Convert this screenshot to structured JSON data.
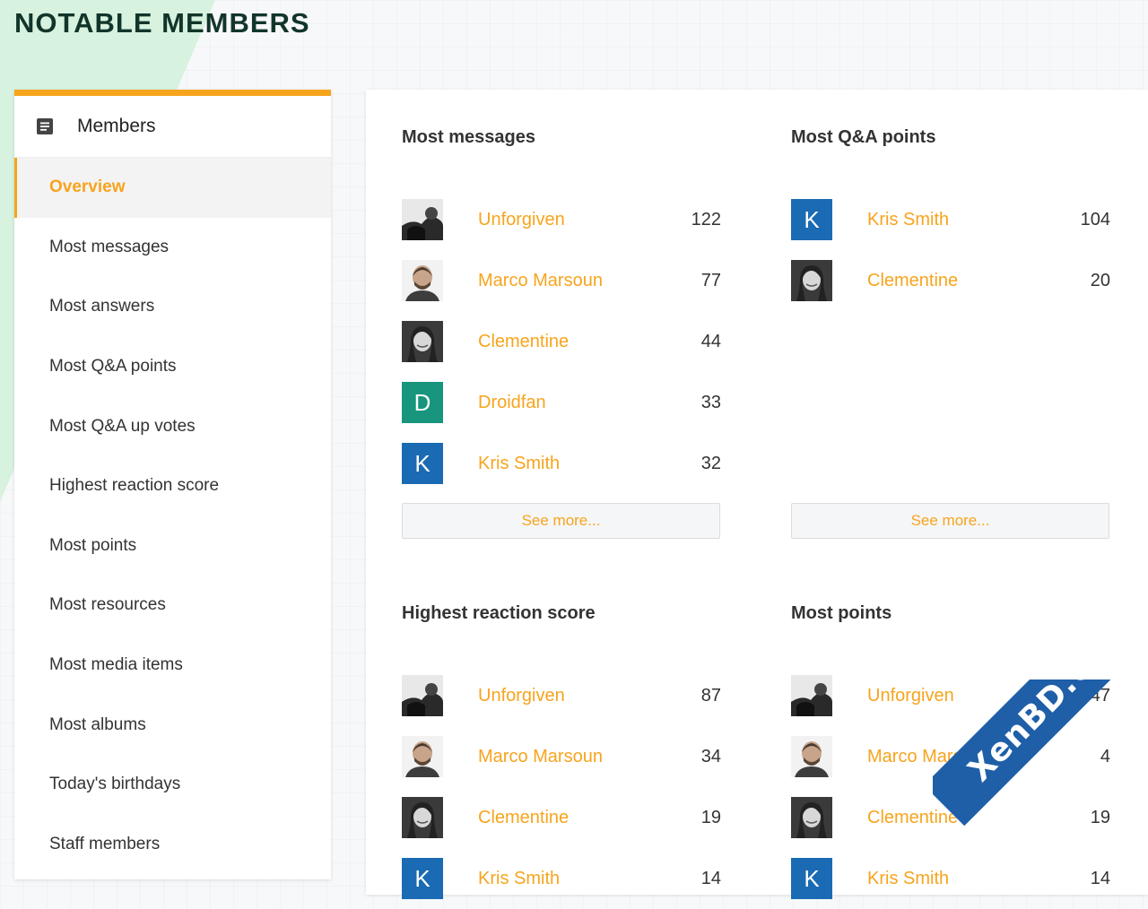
{
  "page": {
    "title": "NOTABLE MEMBERS"
  },
  "sidebar": {
    "header_title": "Members",
    "icon": "document-icon",
    "items": [
      {
        "label": "Overview",
        "active": true
      },
      {
        "label": "Most messages"
      },
      {
        "label": "Most answers"
      },
      {
        "label": "Most Q&A points"
      },
      {
        "label": "Most Q&A up votes"
      },
      {
        "label": "Highest reaction score"
      },
      {
        "label": "Most points"
      },
      {
        "label": "Most resources"
      },
      {
        "label": "Most media items"
      },
      {
        "label": "Most albums"
      },
      {
        "label": "Today's birthdays"
      },
      {
        "label": "Staff members"
      }
    ]
  },
  "blocks": {
    "most_messages": {
      "title": "Most messages",
      "see_more": "See more...",
      "rows": [
        {
          "name": "Unforgiven",
          "count": "122",
          "avatar": "photo-unforgiven"
        },
        {
          "name": "Marco Marsoun",
          "count": "77",
          "avatar": "photo-marco"
        },
        {
          "name": "Clementine",
          "count": "44",
          "avatar": "photo-clementine"
        },
        {
          "name": "Droidfan",
          "count": "33",
          "avatar": "letter",
          "letter": "D",
          "color": "#17957d"
        },
        {
          "name": "Kris Smith",
          "count": "32",
          "avatar": "letter",
          "letter": "K",
          "color": "#1a6bb3"
        }
      ]
    },
    "most_qa_points": {
      "title": "Most Q&A points",
      "see_more": "See more...",
      "rows": [
        {
          "name": "Kris Smith",
          "count": "104",
          "avatar": "letter",
          "letter": "K",
          "color": "#1a6bb3"
        },
        {
          "name": "Clementine",
          "count": "20",
          "avatar": "photo-clementine"
        }
      ]
    },
    "highest_reaction_score": {
      "title": "Highest reaction score",
      "rows": [
        {
          "name": "Unforgiven",
          "count": "87",
          "avatar": "photo-unforgiven"
        },
        {
          "name": "Marco Marsoun",
          "count": "34",
          "avatar": "photo-marco"
        },
        {
          "name": "Clementine",
          "count": "19",
          "avatar": "photo-clementine"
        },
        {
          "name": "Kris Smith",
          "count": "14",
          "avatar": "letter",
          "letter": "K",
          "color": "#1a6bb3"
        }
      ]
    },
    "most_points": {
      "title": "Most points",
      "rows": [
        {
          "name": "Unforgiven",
          "count": "47",
          "avatar": "photo-unforgiven"
        },
        {
          "name": "Marco Marsoun",
          "count": "4",
          "avatar": "photo-marco"
        },
        {
          "name": "Clementine",
          "count": "19",
          "avatar": "photo-clementine"
        },
        {
          "name": "Kris Smith",
          "count": "14",
          "avatar": "letter",
          "letter": "K",
          "color": "#1a6bb3"
        }
      ]
    }
  },
  "watermark": {
    "text": "XenBD.Com"
  },
  "colors": {
    "accent": "#f7a41d",
    "title": "#12352a",
    "kris": "#1a6bb3",
    "droidfan": "#17957d",
    "watermark": "#1e5fa8"
  }
}
